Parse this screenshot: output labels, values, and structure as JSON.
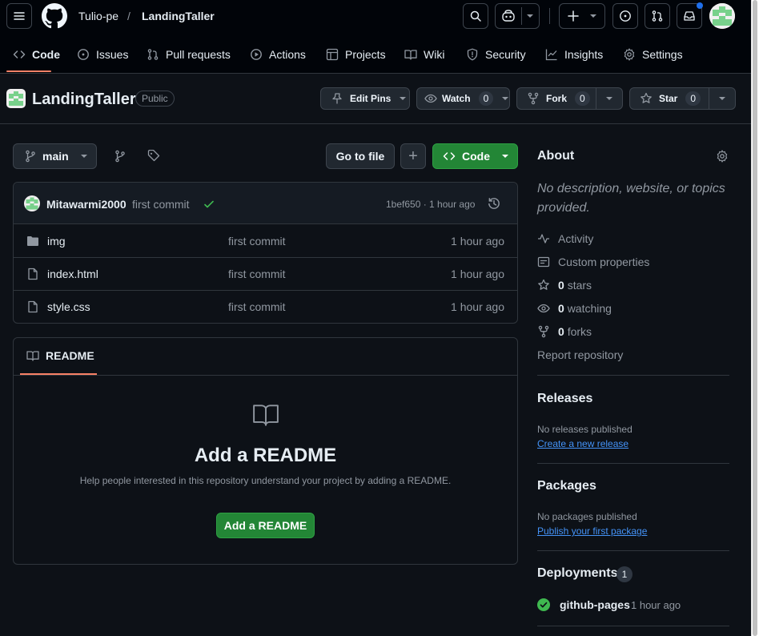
{
  "header": {
    "owner": "Tulio-pe",
    "separator": "/",
    "repo": "LandingTaller",
    "menu_icon": "hamburger-icon",
    "logo_icon": "github-logo-icon"
  },
  "tabs": [
    {
      "label": "Code",
      "icon": "code-icon",
      "active": true
    },
    {
      "label": "Issues",
      "icon": "issue-icon"
    },
    {
      "label": "Pull requests",
      "icon": "pull-request-icon"
    },
    {
      "label": "Actions",
      "icon": "play-icon"
    },
    {
      "label": "Projects",
      "icon": "table-icon"
    },
    {
      "label": "Wiki",
      "icon": "book-icon"
    },
    {
      "label": "Security",
      "icon": "shield-icon"
    },
    {
      "label": "Insights",
      "icon": "graph-icon"
    },
    {
      "label": "Settings",
      "icon": "gear-icon"
    }
  ],
  "repohead": {
    "name": "LandingTaller",
    "visibility": "Public",
    "edit_pins": "Edit Pins",
    "watch": "Watch",
    "watch_count": "0",
    "fork": "Fork",
    "fork_count": "0",
    "star": "Star",
    "star_count": "0"
  },
  "toolbar": {
    "branch": "main",
    "go_to_file": "Go to file",
    "add": "+",
    "code": "Code"
  },
  "commit": {
    "author": "Mitawarmi2000",
    "message": "first commit",
    "meta": "1bef650 · 1 hour ago"
  },
  "files": [
    {
      "name": "img",
      "type": "folder",
      "message": "first commit",
      "age": "1 hour ago"
    },
    {
      "name": "index.html",
      "type": "file",
      "message": "first commit",
      "age": "1 hour ago"
    },
    {
      "name": "style.css",
      "type": "file",
      "message": "first commit",
      "age": "1 hour ago"
    }
  ],
  "readme": {
    "tab": "README",
    "title": "Add a README",
    "description": "Help people interested in this repository understand your project by adding a README.",
    "button": "Add a README"
  },
  "about": {
    "title": "About",
    "description": "No description, website, or topics provided.",
    "activity": "Activity",
    "custom_properties": "Custom properties",
    "stars_count": "0",
    "stars_label": "stars",
    "watching_count": "0",
    "watching_label": "watching",
    "forks_count": "0",
    "forks_label": "forks",
    "report": "Report repository"
  },
  "releases": {
    "title": "Releases",
    "empty": "No releases published",
    "link": "Create a new release"
  },
  "packages": {
    "title": "Packages",
    "empty": "No packages published",
    "link": "Publish your first package"
  },
  "deployments": {
    "title": "Deployments",
    "count": "1",
    "name": "github-pages",
    "age": "1 hour ago"
  },
  "colors": {
    "background": "#0d1117",
    "header": "#010409",
    "accent_green": "#238636",
    "link": "#4493f8",
    "tab_underline": "#f78166"
  }
}
